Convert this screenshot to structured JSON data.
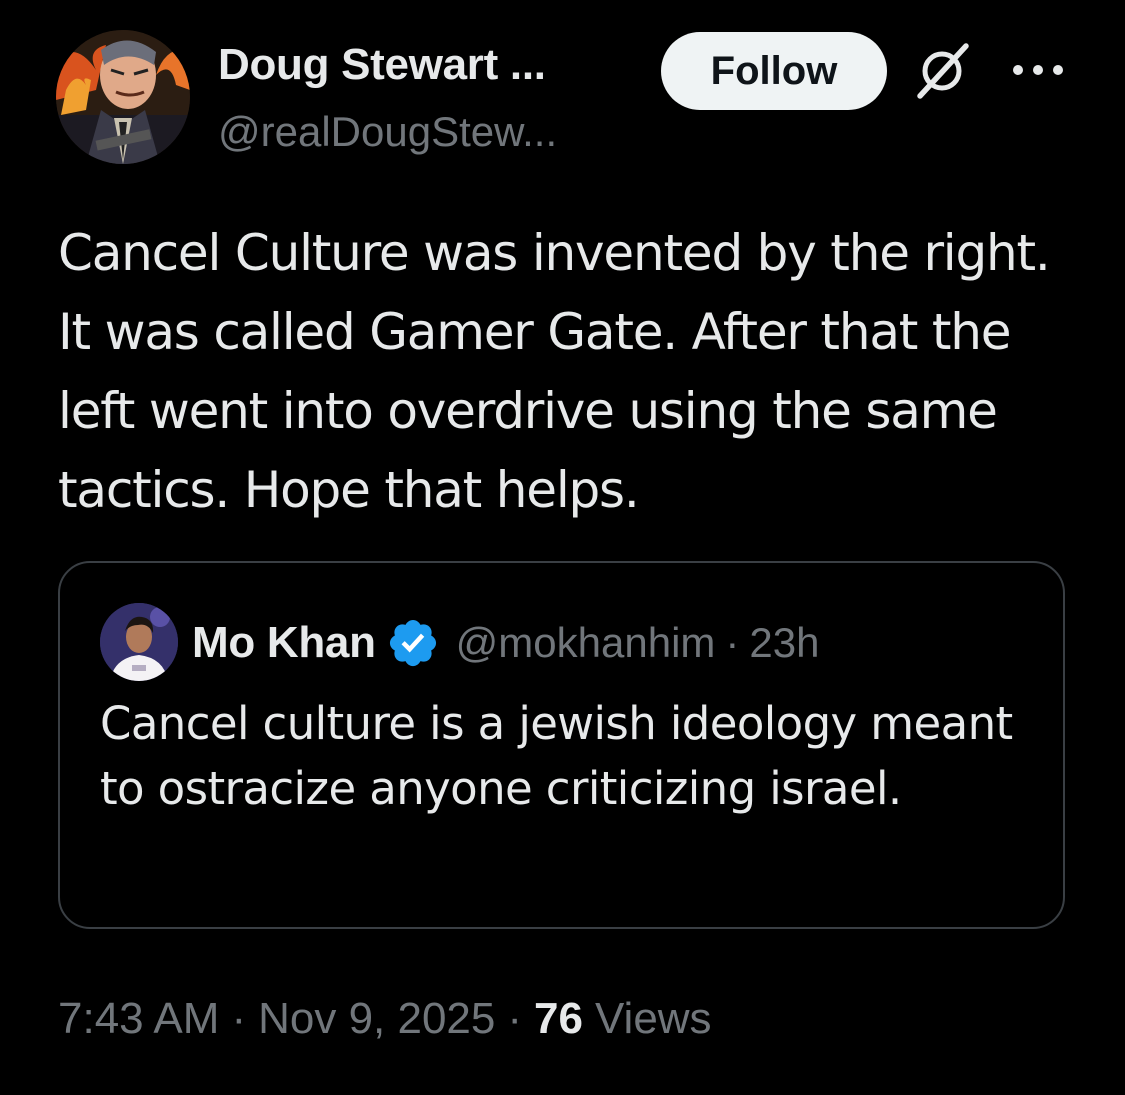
{
  "author": {
    "display_name": "Doug Stewart ...",
    "handle": "@realDougStew..."
  },
  "actions": {
    "follow_label": "Follow",
    "grok_icon": "grok-icon",
    "more_icon": "more-dots-icon"
  },
  "tweet": {
    "text": "Cancel Culture was invented by the right. It was called Gamer Gate. After that the left went into overdrive using the same tactics. Hope that helps."
  },
  "quoted_tweet": {
    "display_name": "Mo Khan",
    "verified_icon": "verified-badge-icon",
    "handle": "@mokhanhim",
    "separator": "·",
    "time": "23h",
    "text": "Cancel culture is a jewish ideology meant to ostracize anyone criticizing israel."
  },
  "meta": {
    "time": "7:43 AM",
    "separator": "·",
    "date": "Nov 9, 2025",
    "views_count": "76",
    "views_label": "Views"
  },
  "colors": {
    "background": "#000000",
    "primary_text": "#e7e9ea",
    "secondary_text": "#71767b",
    "verified_blue": "#1d9bf0",
    "follow_button_bg": "#eff3f4",
    "border": "#3a3f44"
  }
}
